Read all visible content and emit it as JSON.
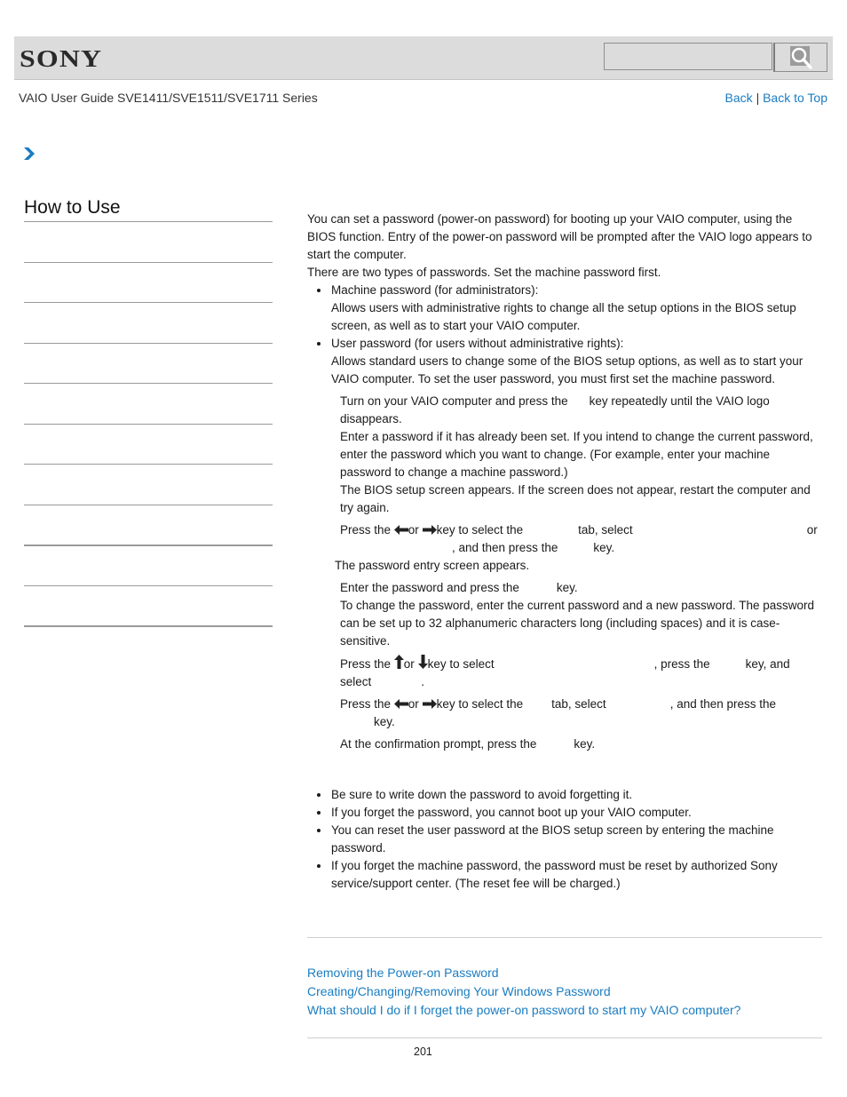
{
  "header": {
    "logo": "SONY",
    "search_placeholder": "",
    "search_icon": "magnifier-icon",
    "guide_title": "VAIO User Guide SVE1411/SVE1511/SVE1711 Series",
    "links": {
      "back": "Back",
      "separator": "|",
      "back_to_top": "Back to Top"
    },
    "accent_color": "#1a7cc1"
  },
  "breadcrumb": {
    "icon": "chevron-right-icon"
  },
  "sidebar": {
    "title": "How to Use",
    "items": [
      "",
      "",
      "",
      "",
      "",
      "",
      "",
      "",
      "",
      ""
    ]
  },
  "main": {
    "intro": [
      "You can set a password (power-on password) for booting up your VAIO computer, using the BIOS function. Entry of the power-on password will be prompted after the VAIO logo appears to start the computer.",
      "There are two types of passwords. Set the machine password first."
    ],
    "types": [
      {
        "title": "Machine password (for administrators):",
        "desc": "Allows users with administrative rights to change all the setup options in the BIOS setup screen, as well as to start your VAIO computer."
      },
      {
        "title": "User password (for users without administrative rights):",
        "desc": "Allows standard users to change some of the BIOS setup options, as well as to start your VAIO computer. To set the user password, you must first set the machine password."
      }
    ],
    "steps": {
      "s1_a": "Turn on your VAIO computer and press the",
      "s1_b": "key repeatedly until the VAIO logo disappears.",
      "s1_c": "Enter a password if it has already been set. If you intend to change the current password, enter the password which you want to change. (For example, enter your machine password to change a machine password.)",
      "s1_d": "The BIOS setup screen appears. If the screen does not appear, restart the computer and try again.",
      "s2_a": "Press the",
      "s2_or": "or",
      "s2_b": "key to select the",
      "s2_c": "tab, select",
      "s2_d": "or",
      "s2_e": ", and then press the",
      "s2_f": "key.",
      "s2_g": "The password entry screen appears.",
      "s3_a": "Enter the password and press the",
      "s3_b": "key.",
      "s3_c": "To change the password, enter the current password and a new password. The password can be set up to 32 alphanumeric characters long (including spaces) and it is case-sensitive.",
      "s4_a": "Press the",
      "s4_or": "or",
      "s4_b": "key to select",
      "s4_c": ", press the",
      "s4_d": "key, and",
      "s4_e": "select",
      "s4_f": ".",
      "s5_a": "Press the",
      "s5_or": "or",
      "s5_b": "key to select the",
      "s5_c": "tab, select",
      "s5_d": ", and then press the",
      "s5_e": "key.",
      "s6_a": "At the confirmation prompt, press the",
      "s6_b": "key."
    },
    "notes": [
      "Be sure to write down the password to avoid forgetting it.",
      "If you forget the password, you cannot boot up your VAIO computer.",
      "You can reset the user password at the BIOS setup screen by entering the machine password.",
      "If you forget the machine password, the password must be reset by authorized Sony service/support center. (The reset fee will be charged.)"
    ],
    "related_links": [
      "Removing the Power-on Password",
      "Creating/Changing/Removing Your Windows Password",
      "What should I do if I forget the power-on password to start my VAIO computer?"
    ]
  },
  "footer": {
    "page_number": "201"
  }
}
